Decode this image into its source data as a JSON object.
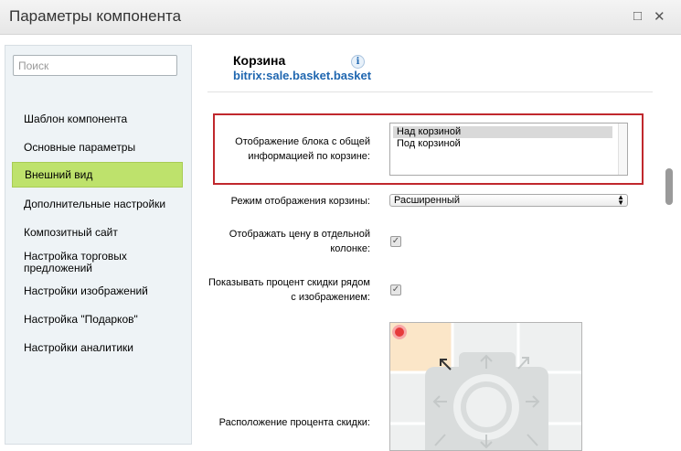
{
  "window": {
    "title": "Параметры компонента",
    "restore_glyph": "□",
    "close_glyph": "✕"
  },
  "sidebar": {
    "search_placeholder": "Поиск",
    "items": [
      {
        "label": "Шаблон компонента",
        "active": false
      },
      {
        "label": "Основные параметры",
        "active": false
      },
      {
        "label": "Внешний вид",
        "active": true
      },
      {
        "label": "Дополнительные настройки",
        "active": false
      },
      {
        "label": "Композитный сайт",
        "active": false
      },
      {
        "label": "Настройка торговых предложений",
        "active": false
      },
      {
        "label": "Настройки изображений",
        "active": false
      },
      {
        "label": "Настройка \"Подарков\"",
        "active": false
      },
      {
        "label": "Настройки аналитики",
        "active": false
      }
    ]
  },
  "header": {
    "title": "Корзина",
    "component": "bitrix:sale.basket.basket",
    "info_glyph": "i"
  },
  "fields": {
    "info_block": {
      "label": "Отображение блока с общей информацией по корзине:",
      "options": [
        "Над корзиной",
        "Под корзиной"
      ],
      "selected": "Над корзиной"
    },
    "display_mode": {
      "label": "Режим отображения корзины:",
      "value": "Расширенный",
      "arrow_glyph": "▴▾"
    },
    "price_column": {
      "label": "Отображать цену в отдельной колонке:",
      "checked": true
    },
    "discount_percent": {
      "label": "Показывать процент скидки рядом с изображением:",
      "checked": true
    },
    "discount_position": {
      "label": "Расположение процента скидки:",
      "selected_cell": "top-left"
    }
  },
  "colors": {
    "active_nav": "#bee26c",
    "link_blue": "#2067b0",
    "highlight_border": "#c0282d",
    "selected_cell": "#fbe6c8",
    "marker": "#e63b3b"
  }
}
